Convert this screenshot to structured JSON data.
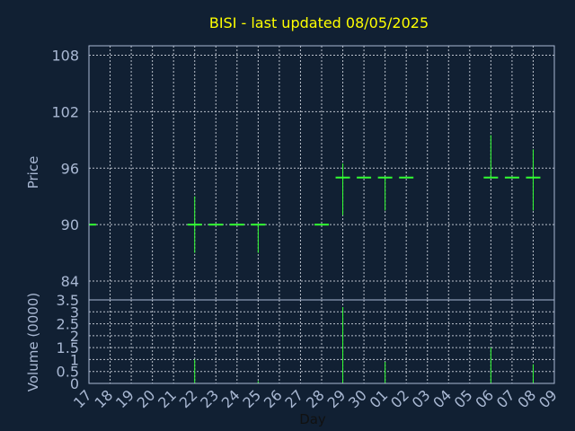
{
  "chart_data": {
    "type": "ohlc",
    "title": "BISI - last updated 08/05/2025",
    "xlabel": "Day",
    "ylabel_price": "Price",
    "ylabel_volume": "Volume (0000)",
    "price_ylim": [
      82,
      109
    ],
    "price_ticks": [
      "84",
      "90",
      "96",
      "102",
      "108"
    ],
    "volume_ylim": [
      0,
      3.5
    ],
    "volume_ticks": [
      "0",
      "0.5",
      "1",
      "1.5",
      "2",
      "2.5",
      "3",
      "3.5"
    ],
    "x_tick_labels": [
      "17",
      "18",
      "19",
      "20",
      "21",
      "22",
      "23",
      "24",
      "25",
      "26",
      "27",
      "28",
      "29",
      "30",
      "01",
      "02",
      "03",
      "04",
      "05",
      "06",
      "07",
      "08",
      "09"
    ],
    "colors": {
      "up": "#33ff33",
      "volume": "#33ff33",
      "title": "#ffff00",
      "axis": "#a9b8d3",
      "background": "#112033"
    },
    "bars": [
      {
        "day": "17",
        "open": 90,
        "high": 90,
        "low": 90,
        "close": 90,
        "volume": 0
      },
      {
        "day": "22",
        "open": 90,
        "high": 93,
        "low": 87,
        "close": 90,
        "volume": 1.0
      },
      {
        "day": "23",
        "open": 90,
        "high": 90,
        "low": 90,
        "close": 90,
        "volume": 0
      },
      {
        "day": "24",
        "open": 90,
        "high": 90,
        "low": 90,
        "close": 90,
        "volume": 0
      },
      {
        "day": "25",
        "open": 90,
        "high": 90,
        "low": 87,
        "close": 90,
        "volume": 0.1
      },
      {
        "day": "28",
        "open": 90,
        "high": 90,
        "low": 90,
        "close": 90,
        "volume": 0
      },
      {
        "day": "29",
        "open": 95,
        "high": 96.5,
        "low": 91,
        "close": 95,
        "volume": 3.2
      },
      {
        "day": "30",
        "open": 95,
        "high": 95,
        "low": 95,
        "close": 95,
        "volume": 0
      },
      {
        "day": "01",
        "open": 95,
        "high": 95,
        "low": 91.5,
        "close": 95,
        "volume": 0.9
      },
      {
        "day": "02",
        "open": 95,
        "high": 95,
        "low": 95,
        "close": 95,
        "volume": 0
      },
      {
        "day": "06",
        "open": 95,
        "high": 99.5,
        "low": 95,
        "close": 95,
        "volume": 1.5
      },
      {
        "day": "07",
        "open": 95,
        "high": 95,
        "low": 95,
        "close": 95,
        "volume": 0
      },
      {
        "day": "08",
        "open": 95,
        "high": 98,
        "low": 91.5,
        "close": 95,
        "volume": 0.8
      }
    ]
  }
}
